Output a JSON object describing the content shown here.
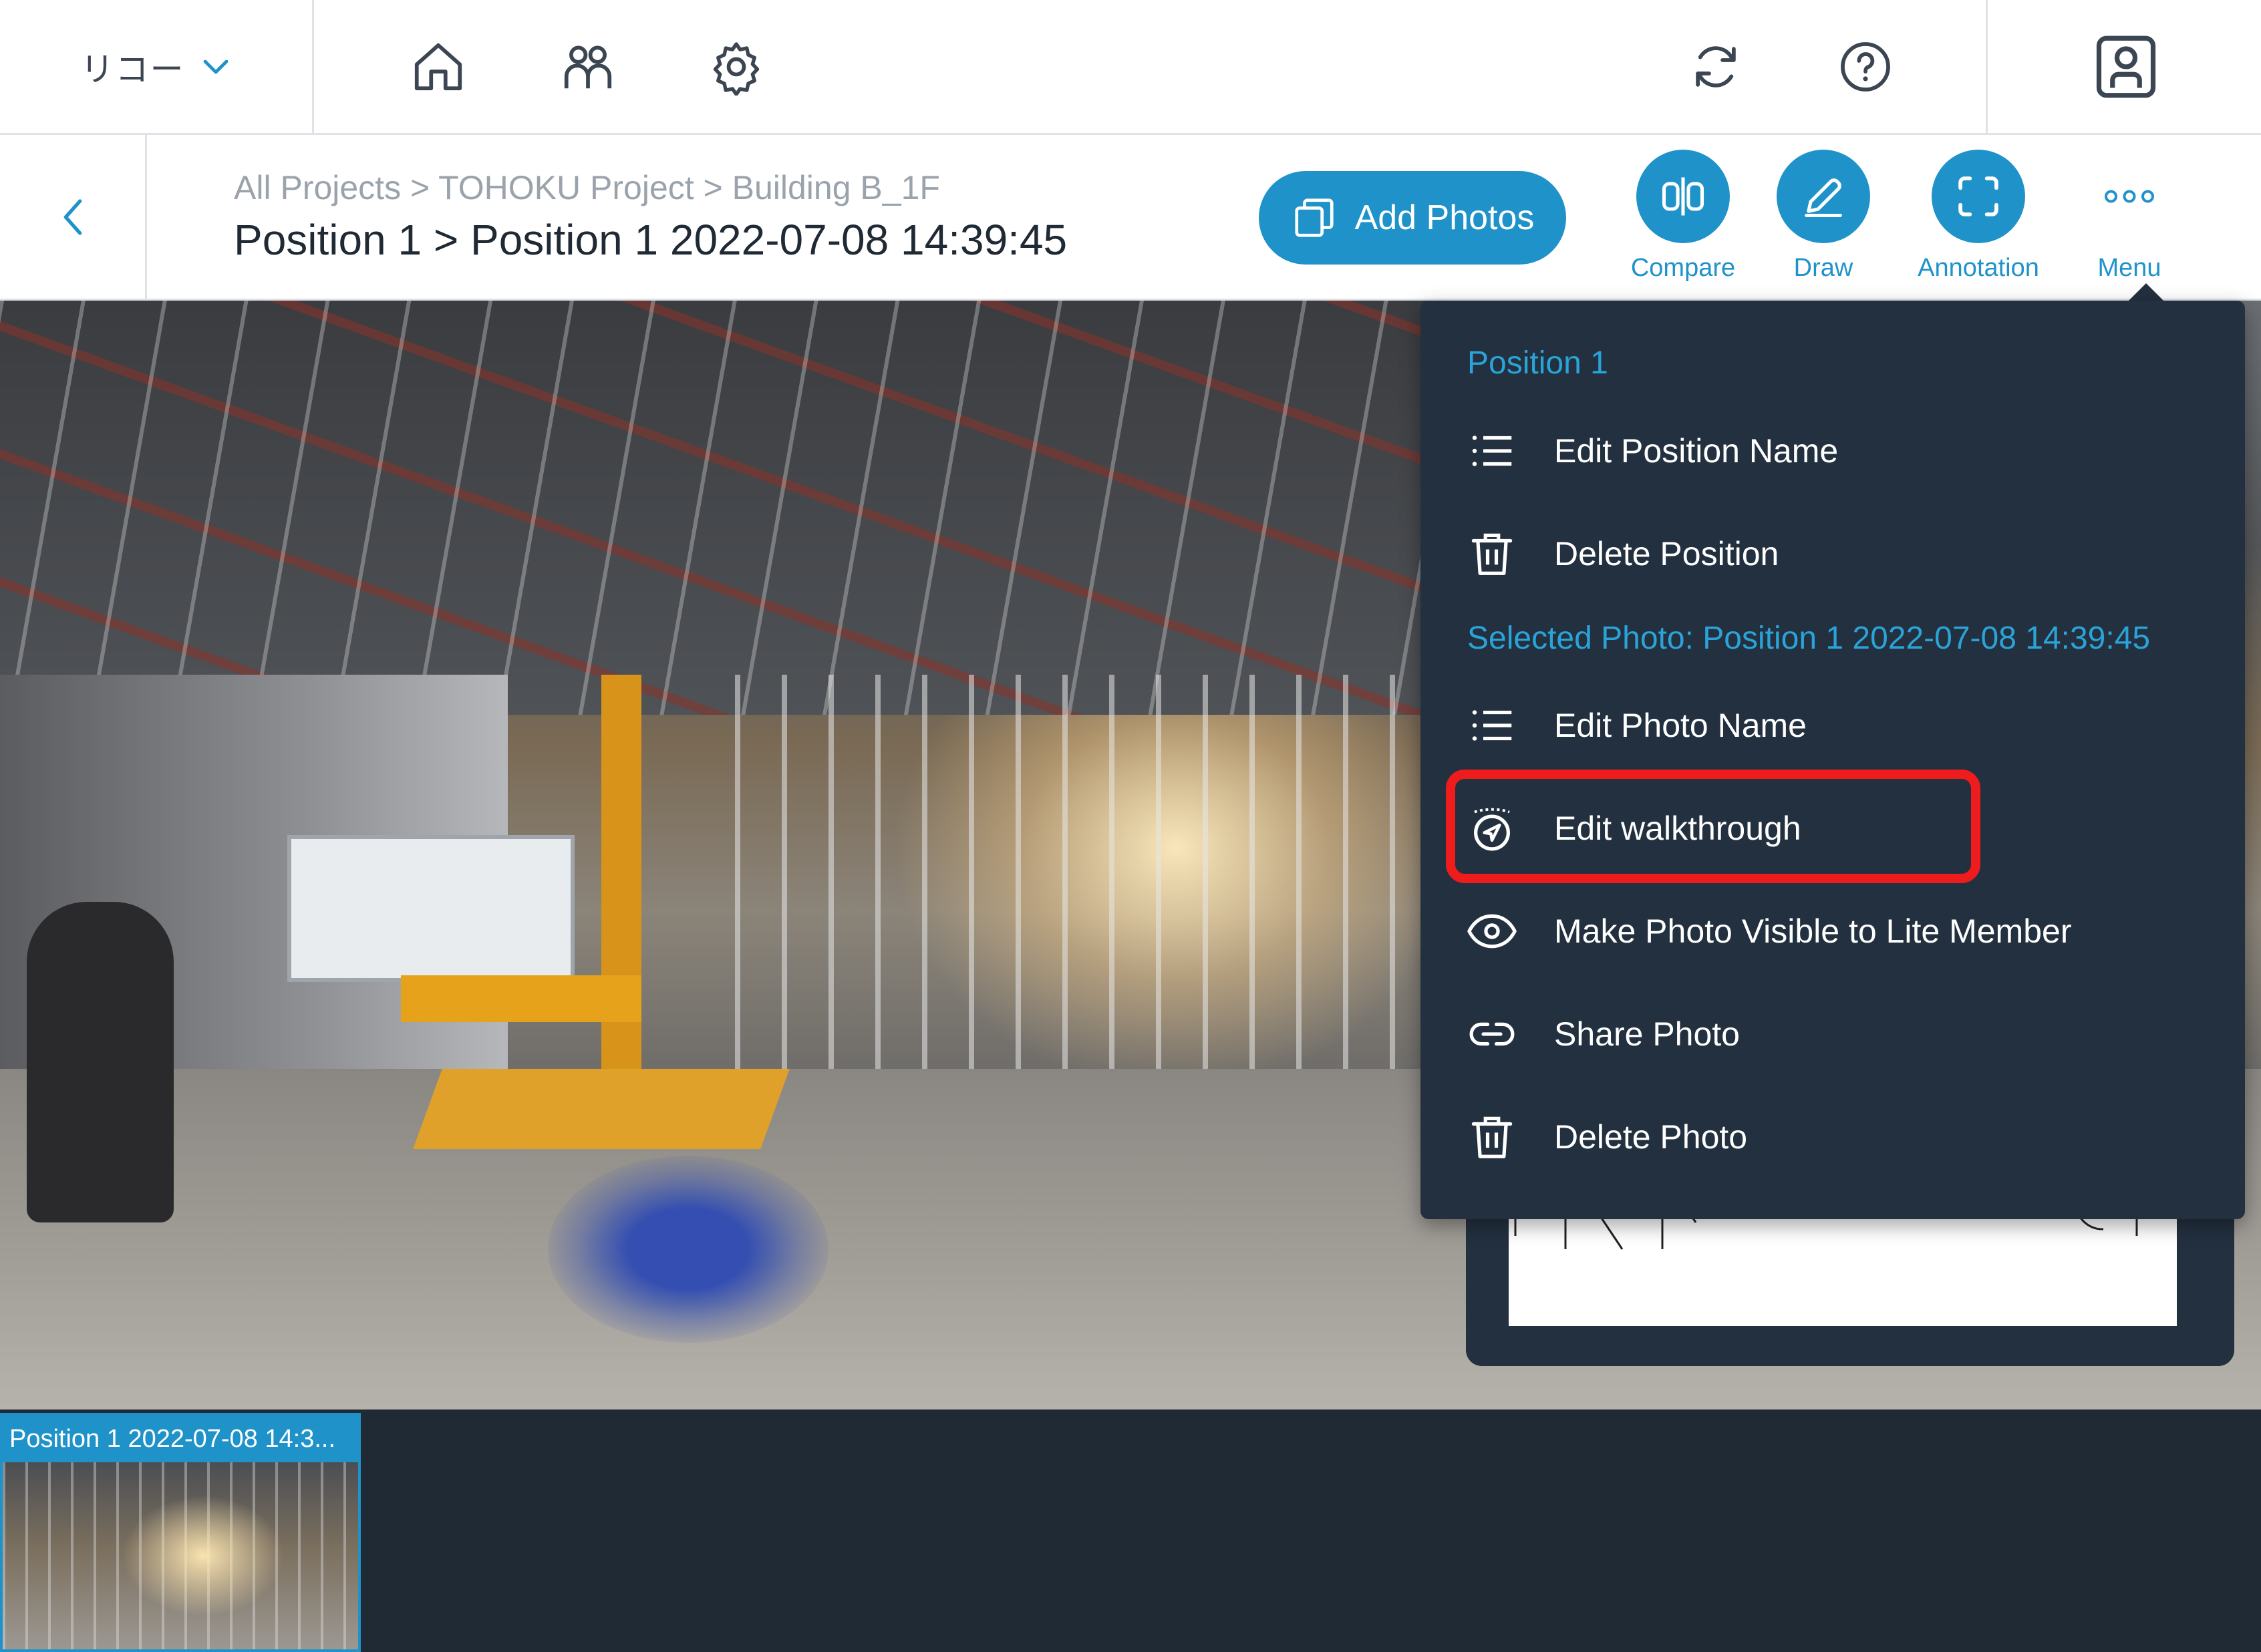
{
  "topbar": {
    "org_name": "リコー",
    "icons": [
      "home-icon",
      "users-icon",
      "gear-icon",
      "sync-icon",
      "help-icon",
      "profile-icon"
    ]
  },
  "subbar": {
    "breadcrumb": "All Projects > TOHOKU Project > Building B_1F",
    "title": "Position 1 > Position 1 2022-07-08 14:39:45",
    "add_photos_label": "Add Photos",
    "tools": {
      "compare": "Compare",
      "draw": "Draw",
      "annotation": "Annotation",
      "menu": "Menu"
    }
  },
  "menu": {
    "section_position": "Position 1",
    "edit_position_name": "Edit Position Name",
    "delete_position": "Delete Position",
    "section_photo": "Selected Photo: Position 1 2022-07-08 14:39:45",
    "edit_photo_name": "Edit Photo Name",
    "edit_walkthrough": "Edit walkthrough",
    "make_visible": "Make Photo Visible to Lite Member",
    "share_photo": "Share Photo",
    "delete_photo": "Delete Photo"
  },
  "filmstrip": {
    "thumb_label": "Position 1 2022-07-08 14:3..."
  },
  "colors": {
    "accent": "#1f93c9",
    "menu_bg": "#23303f",
    "highlight": "#ee1c1c",
    "section_text": "#2aa4d8"
  }
}
